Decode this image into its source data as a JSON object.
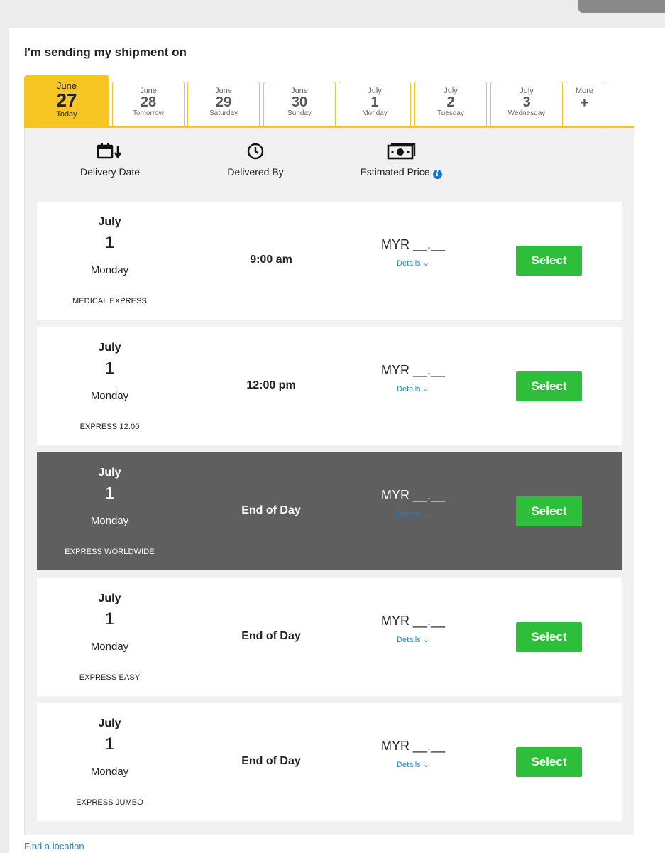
{
  "heading": "I'm sending my shipment on",
  "tabs": [
    {
      "month": "June",
      "day": "27",
      "weekday": "Today",
      "active": true
    },
    {
      "month": "June",
      "day": "28",
      "weekday": "Tomorrow"
    },
    {
      "month": "June",
      "day": "29",
      "weekday": "Saturday"
    },
    {
      "month": "June",
      "day": "30",
      "weekday": "Sunday"
    },
    {
      "month": "July",
      "day": "1",
      "weekday": "Monday"
    },
    {
      "month": "July",
      "day": "2",
      "weekday": "Tuesday"
    },
    {
      "month": "July",
      "day": "3",
      "weekday": "Wednesday"
    }
  ],
  "more_tab": {
    "label": "More",
    "icon": "+"
  },
  "columns": {
    "delivery_date": "Delivery Date",
    "delivered_by": "Delivered By",
    "estimated_price": "Estimated Price",
    "info_icon": "i"
  },
  "options": [
    {
      "month": "July",
      "day": "1",
      "weekday": "Monday",
      "product": "MEDICAL EXPRESS",
      "time": "9:00 am",
      "price": "MYR __.__",
      "details": "Details ⌄",
      "select": "Select"
    },
    {
      "month": "July",
      "day": "1",
      "weekday": "Monday",
      "product": "EXPRESS 12:00",
      "time": "12:00 pm",
      "price": "MYR __.__",
      "details": "Details ⌄",
      "select": "Select"
    },
    {
      "month": "July",
      "day": "1",
      "weekday": "Monday",
      "product": "EXPRESS WORLDWIDE",
      "time": "End of Day",
      "price": "MYR __.__",
      "details": "Details ⌄",
      "select": "Select",
      "highlighted": true
    },
    {
      "month": "July",
      "day": "1",
      "weekday": "Monday",
      "product": "EXPRESS EASY",
      "time": "End of Day",
      "price": "MYR __.__",
      "details": "Details ⌄",
      "select": "Select"
    },
    {
      "month": "July",
      "day": "1",
      "weekday": "Monday",
      "product": "EXPRESS JUMBO",
      "time": "End of Day",
      "price": "MYR __.__",
      "details": "Details ⌄",
      "select": "Select"
    }
  ],
  "footer": {
    "find_location": "Find a location"
  },
  "colors": {
    "accent_yellow": "#f6c524",
    "select_green": "#2dbf3a",
    "highlight_row": "#5f5f5f",
    "link_blue": "#1a8acb"
  }
}
